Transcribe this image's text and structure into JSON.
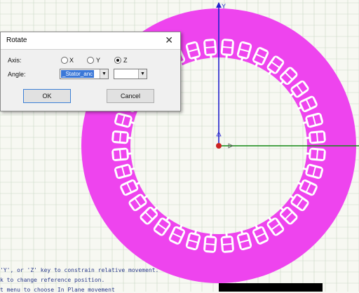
{
  "viewport": {
    "axis_y_label": "Y",
    "status_lines": [
      "'Y', or 'Z' key to constrain relative movement.",
      "k to change reference position.",
      "t menu to choose In Plane movement"
    ],
    "colors": {
      "grid": "#c9d9c5",
      "stator": "#ee44ee",
      "slot": "#ffffff",
      "axis_y": "#2222cc",
      "axis_x": "#118811",
      "axis_z": "#cc2222"
    }
  },
  "dialog": {
    "title": "Rotate",
    "close_icon": "close-icon",
    "axis_label": "Axis:",
    "axis_options": [
      {
        "label": "X",
        "selected": false
      },
      {
        "label": "Y",
        "selected": false
      },
      {
        "label": "Z",
        "selected": true
      }
    ],
    "angle_label": "Angle:",
    "angle_value": "_Stator_anc",
    "unit_value": "",
    "ok_label": "OK",
    "cancel_label": "Cancel"
  }
}
